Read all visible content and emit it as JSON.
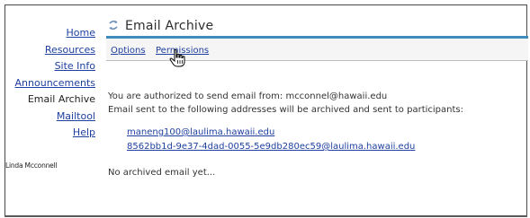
{
  "sidebar": {
    "items": [
      {
        "label": "Home"
      },
      {
        "label": "Resources"
      },
      {
        "label": "Site Info"
      },
      {
        "label": "Announcements"
      },
      {
        "label": "Email Archive"
      },
      {
        "label": "Mailtool"
      },
      {
        "label": "Help"
      }
    ],
    "user_name": "Linda Mcconnell"
  },
  "header": {
    "title": "Email Archive"
  },
  "toolbar": {
    "options_label": "Options",
    "permissions_label": "Permissions"
  },
  "main": {
    "authorized_text": "You are authorized to send email from: mcconnel@hawaii.edu",
    "archived_text": "Email sent to the following addresses will be archived and sent to participants:",
    "addresses": [
      "maneng100@laulima.hawaii.edu",
      "8562bb1d-9e37-4dad-0055-5e9db280ec59@laulima.hawaii.edu"
    ],
    "empty_text": "No archived email yet..."
  },
  "colors": {
    "link": "#1f40a0",
    "title_rule": "#3f8bbd",
    "toolbar_bg": "#f5f5f5"
  }
}
